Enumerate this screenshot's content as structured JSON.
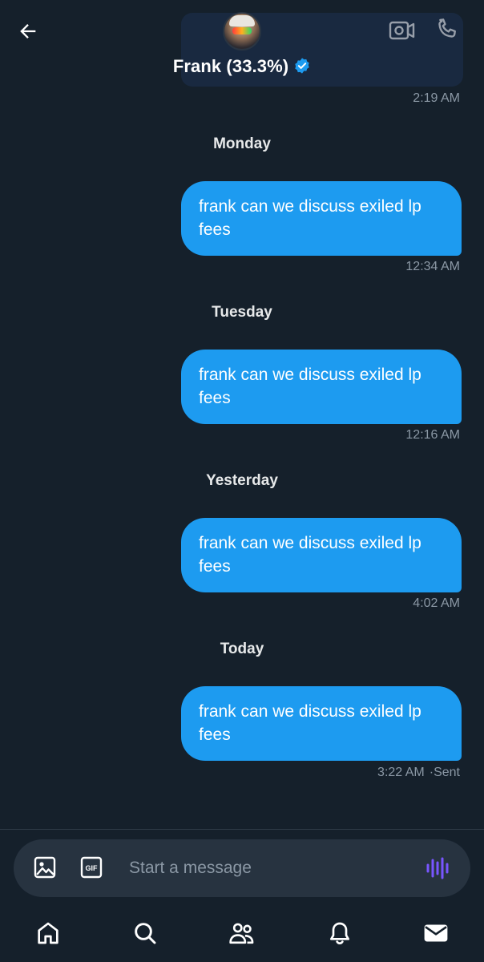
{
  "header": {
    "contact_name": "Frank (33.3%)",
    "verified": true,
    "accent_color": "#1d9bf0",
    "icons": [
      "back-arrow-icon",
      "avatar",
      "verified-badge-icon",
      "video-call-icon",
      "phone-icon"
    ]
  },
  "conversation": {
    "top_timestamp": "2:19 AM",
    "days": [
      {
        "label": "Monday",
        "message": "frank can we discuss exiled lp fees",
        "time": "12:34 AM"
      },
      {
        "label": "Tuesday",
        "message": "frank can we discuss exiled lp fees",
        "time": "12:16 AM"
      },
      {
        "label": "Yesterday",
        "message": "frank can we discuss exiled lp fees",
        "time": "4:02 AM"
      },
      {
        "label": "Today",
        "message": "frank can we discuss exiled lp fees",
        "time": "3:22 AM",
        "status": "·Sent"
      }
    ]
  },
  "composer": {
    "placeholder": "Start a message",
    "gif_label": "GIF",
    "icons": [
      "image-icon",
      "gif-icon",
      "voice-message-icon"
    ],
    "voice_color": "#7856ff"
  },
  "tabbar": {
    "items": [
      "home-icon",
      "search-icon",
      "communities-icon",
      "notifications-icon",
      "messages-icon"
    ],
    "active": "messages-icon"
  }
}
